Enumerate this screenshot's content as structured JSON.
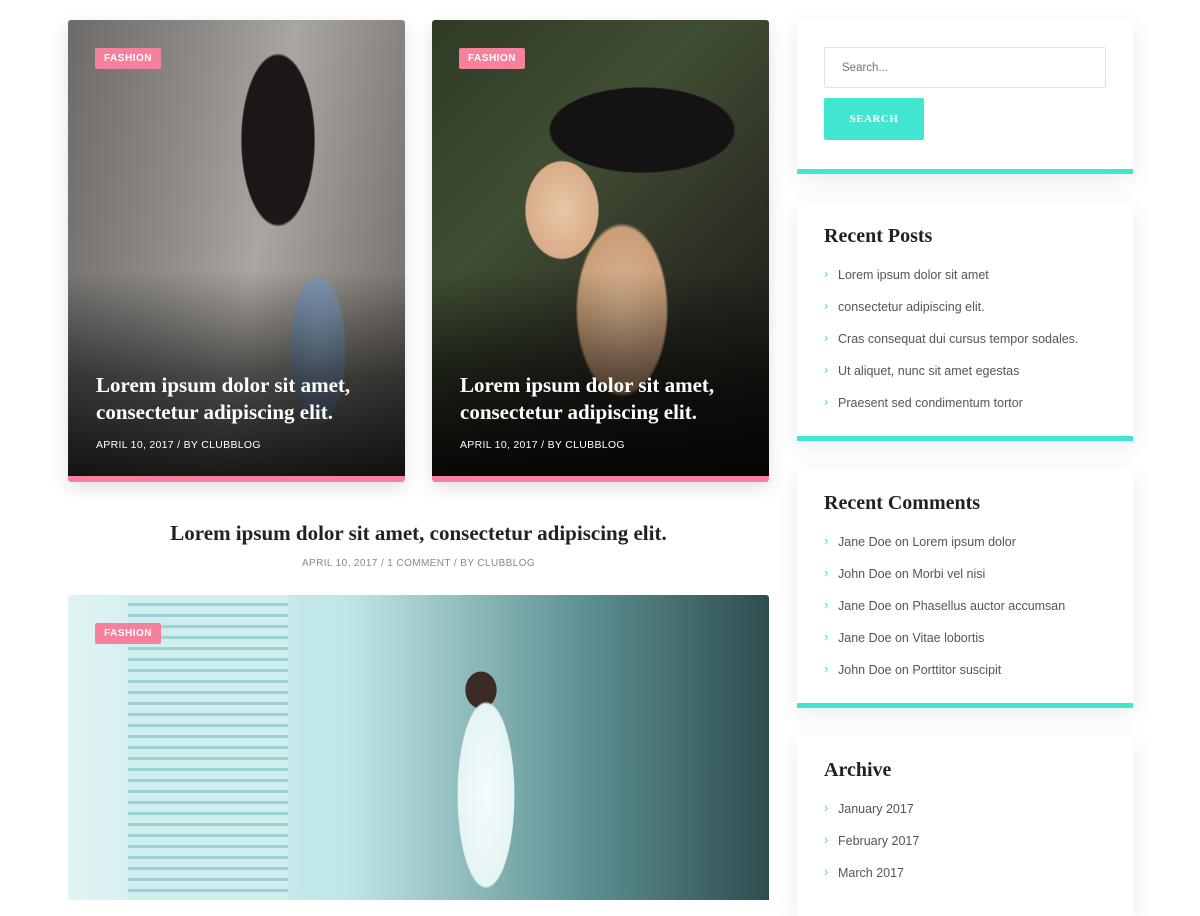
{
  "colors": {
    "pink": "#f7809c",
    "teal": "#40e6d0",
    "text": "#222222",
    "muted": "#777777"
  },
  "cards": [
    {
      "badge": "FASHION",
      "title": "Lorem ipsum dolor sit amet, consectetur adipiscing elit.",
      "meta": "APRIL 10, 2017 / BY CLUBBLOG"
    },
    {
      "badge": "FASHION",
      "title": "Lorem ipsum dolor sit amet, consectetur adipiscing elit.",
      "meta": "APRIL 10, 2017 / BY CLUBBLOG"
    }
  ],
  "featured": {
    "title": "Lorem ipsum dolor sit amet, consectetur adipiscing elit.",
    "meta": "APRIL 10, 2017 / 1 COMMENT / BY CLUBBLOG",
    "badge": "FASHION"
  },
  "search": {
    "placeholder": "Search...",
    "button": "SEARCH"
  },
  "recent_posts": {
    "title": "Recent Posts",
    "items": [
      "Lorem ipsum dolor sit amet",
      "consectetur adipiscing elit.",
      "Cras consequat dui cursus tempor sodales.",
      "Ut aliquet, nunc sit amet egestas",
      "Praesent sed condimentum tortor"
    ]
  },
  "recent_comments": {
    "title": "Recent Comments",
    "items": [
      "Jane Doe on Lorem ipsum dolor",
      "John Doe on Morbi vel nisi",
      "Jane Doe on Phasellus auctor accumsan",
      "Jane Doe on Vitae lobortis",
      "John Doe on Porttitor suscipit"
    ]
  },
  "archive": {
    "title": "Archive",
    "items": [
      "January 2017",
      "February 2017",
      "March 2017"
    ]
  },
  "icons": {
    "list_bullet": "chevron-right-icon"
  }
}
